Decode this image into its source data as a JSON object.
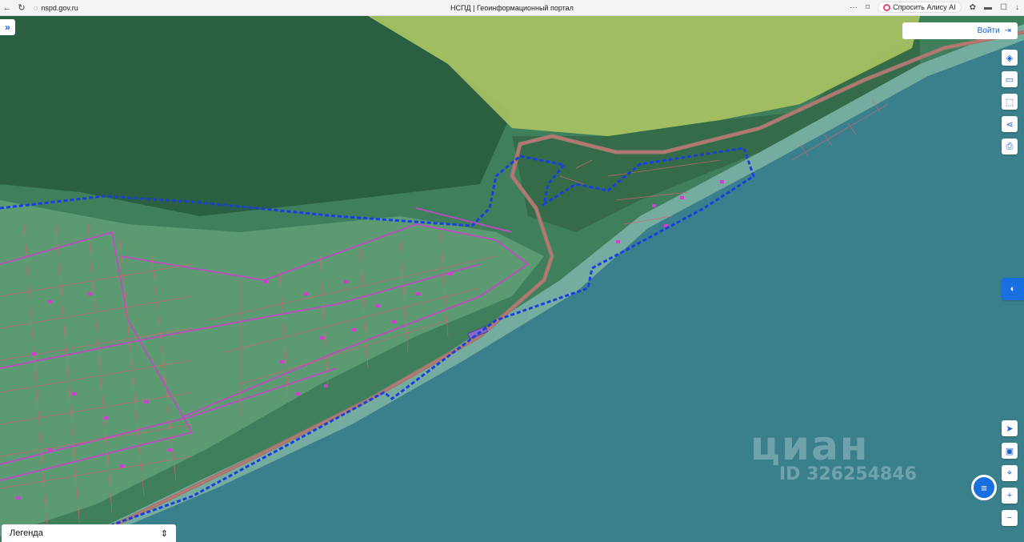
{
  "browser": {
    "url": "nspd.gov.ru",
    "tab_title": "НСПД | Геоинформационный портал",
    "alice_label": "Спросить Алису AI",
    "menu_glyph": "···"
  },
  "map": {
    "login_label": "Войти",
    "legend_label": "Легенда",
    "watermark_brand": "циан",
    "watermark_id": "ID 326254846",
    "colors": {
      "water": "#3a7f8c",
      "forest": "#2e6b4e",
      "field": "#a4c46a",
      "boundary": "#1a3fe0",
      "parcel": "#e0607a",
      "zone": "#d040d0",
      "accent": "#1a6fe0"
    }
  },
  "icons": {
    "back": "←",
    "refresh": "↻",
    "expand": "»",
    "login": "⇥",
    "layers": "◈",
    "ruler": "▭",
    "select": "⬚",
    "share": "⋖",
    "print": "⎙",
    "locate": "➤",
    "screen": "▣",
    "pin": "⌖",
    "zoom_in": "+",
    "zoom_out": "−",
    "chat": "≡",
    "legend_toggle": "⇕"
  }
}
